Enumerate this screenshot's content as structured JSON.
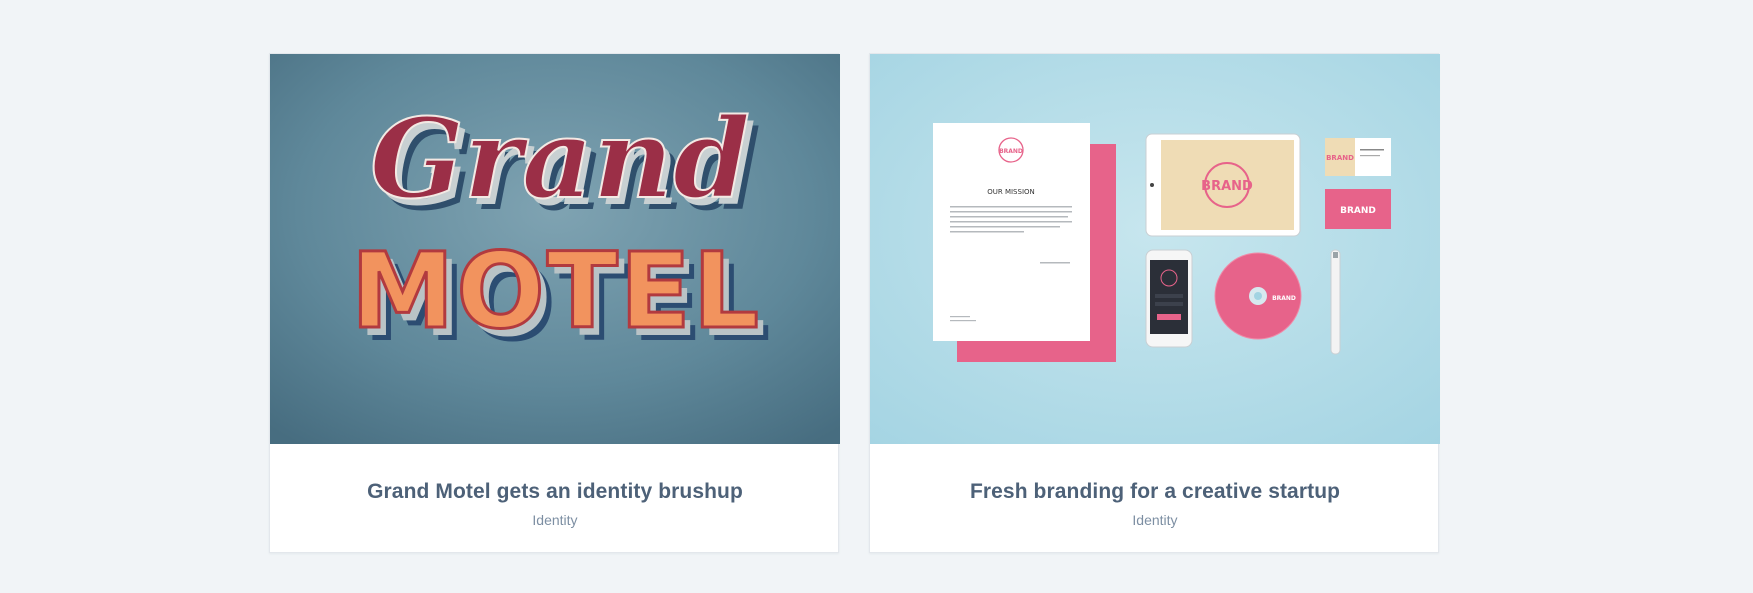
{
  "portfolio": {
    "cards": [
      {
        "title": "Grand Motel gets an identity brushup",
        "category": "Identity",
        "image": {
          "script_word": "Grand",
          "block_word": "MOTEL"
        }
      },
      {
        "title": "Fresh branding for a creative startup",
        "category": "Identity",
        "image": {
          "brand_mark": "BRAND",
          "letter_heading": "OUR MISSION"
        }
      }
    ]
  },
  "colors": {
    "page_background": "#f1f4f7",
    "card_background": "#ffffff",
    "title_text": "#4d6178",
    "category_text": "#7d8fa3",
    "motel_background": "#5c8395",
    "motel_orange": "#f2935e",
    "motel_red": "#a4324a",
    "brand_background": "#a9d7e4",
    "brand_pink": "#e7638a"
  }
}
